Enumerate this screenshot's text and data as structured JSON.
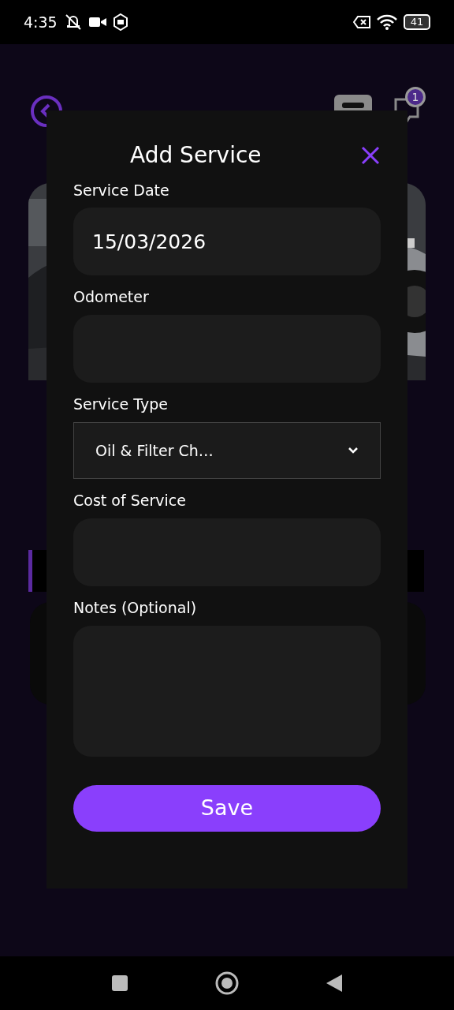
{
  "status_bar": {
    "time": "4:35",
    "battery": "41"
  },
  "header": {
    "badge": "1"
  },
  "dialog": {
    "title": "Add Service",
    "fields": [
      {
        "kind": "input",
        "label": "Service Date",
        "value": "15/03/2026"
      },
      {
        "kind": "input",
        "label": "Odometer"
      },
      {
        "kind": "select",
        "label": "Service Type",
        "value": "Oil & Filter Ch…"
      },
      {
        "kind": "input",
        "label": "Cost of Service"
      },
      {
        "kind": "textarea",
        "label": "Notes (Optional)"
      }
    ],
    "save_button": "Save"
  }
}
